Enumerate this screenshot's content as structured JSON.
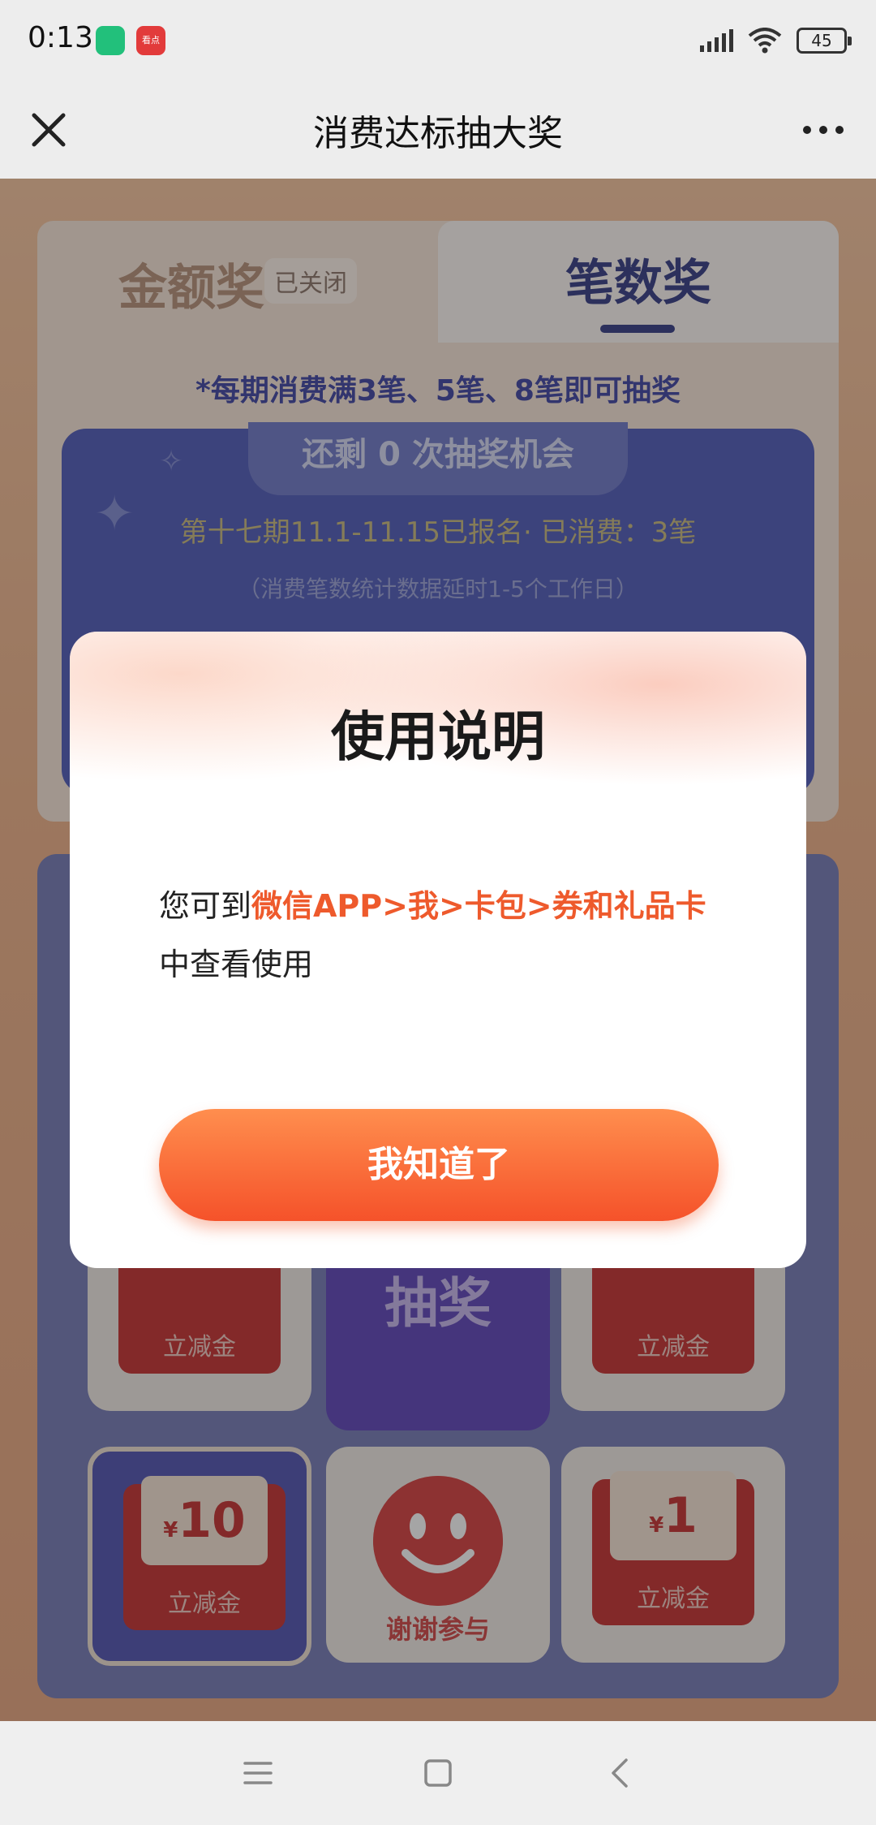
{
  "status": {
    "time": "0:13",
    "apps": [
      "shield-app-icon",
      "news-app-icon"
    ],
    "news_app_label": "看点",
    "battery": "45"
  },
  "nav": {
    "title": "消费达标抽大奖",
    "close_icon": "close-icon",
    "more_icon": "more-icon"
  },
  "tabs": {
    "amount": {
      "label": "金额奖",
      "badge": "已关闭"
    },
    "count": {
      "label": "笔数奖"
    }
  },
  "rule": "*每期消费满3笔、5笔、8笔即可抽奖",
  "chance": {
    "remaining": "还剩 0 次抽奖机会",
    "period": "第十七期11.1-11.15已报名· 已消费：3笔",
    "delay_note": "（消费笔数统计数据延时1-5个工作日）"
  },
  "grid": {
    "draw_label": "抽奖",
    "prize_label": "立减金",
    "prizes": [
      {
        "currency": "¥",
        "amount": "10",
        "label": "立减金"
      },
      {
        "currency": "¥",
        "amount": "1",
        "label": "立减金"
      }
    ],
    "thanks_label": "谢谢参与"
  },
  "modal": {
    "title": "使用说明",
    "body_prefix": "您可到",
    "body_highlight": "微信APP>我>卡包>券和礼品卡",
    "body_suffix": "中查看使用",
    "confirm_label": "我知道了",
    "accent": "#ee5a2c",
    "button_color": "#f5522a"
  },
  "system_nav": [
    "menu-icon",
    "home-icon",
    "back-icon"
  ]
}
